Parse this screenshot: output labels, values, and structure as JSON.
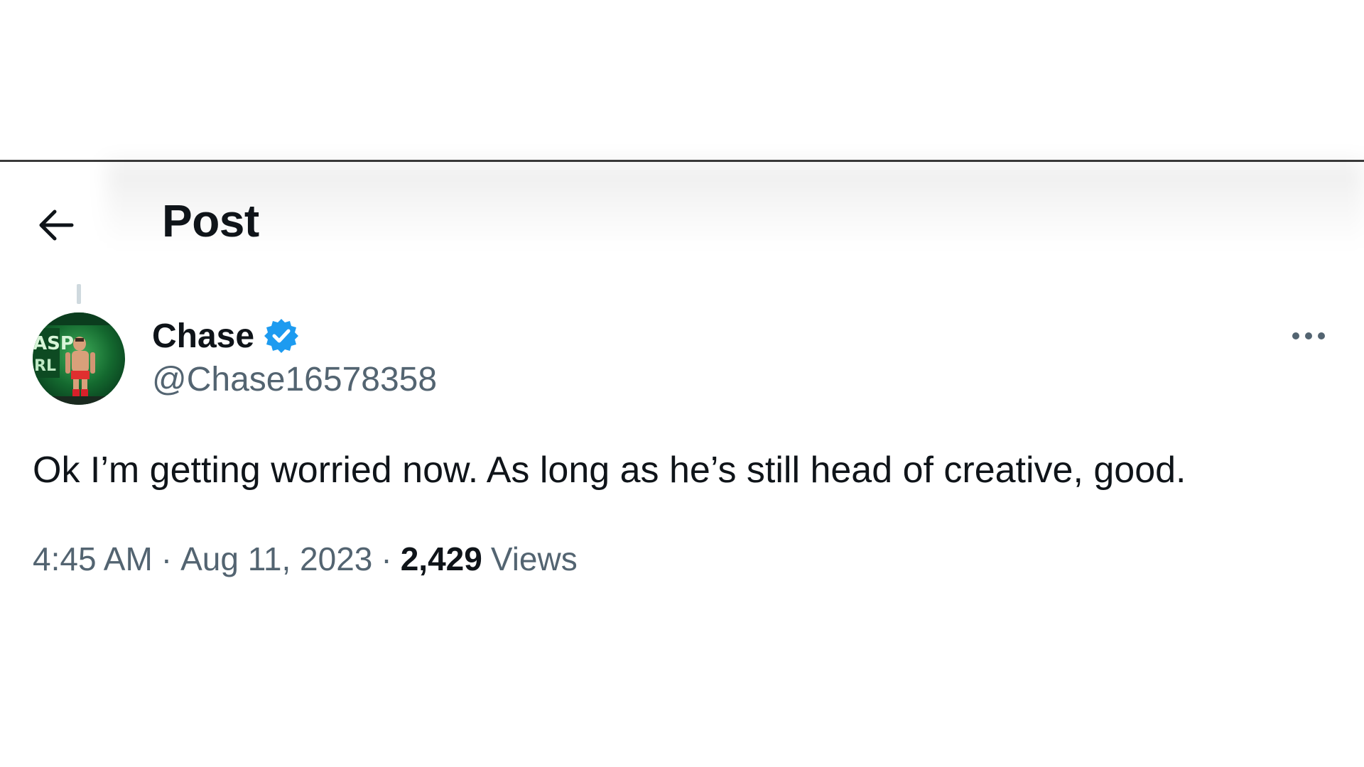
{
  "header": {
    "title": "Post",
    "back_icon": "arrow-left-icon"
  },
  "post": {
    "author": {
      "display_name": "Chase",
      "handle": "@Chase16578358",
      "verified": true,
      "verified_color": "#1d9bf0"
    },
    "text": "Ok I’m getting worried now. As long as he’s still head of creative, good.",
    "time": "4:45 AM",
    "separator": "·",
    "date": "Aug 11, 2023",
    "views_count": "2,429",
    "views_label": "Views",
    "more_icon": "more-horizontal-icon"
  },
  "colors": {
    "text_primary": "#0f1419",
    "text_secondary": "#536471",
    "accent": "#1d9bf0"
  }
}
